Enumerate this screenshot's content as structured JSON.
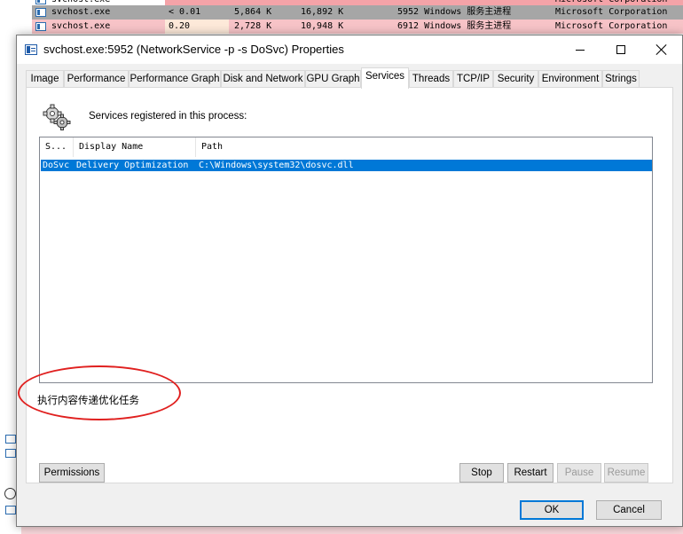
{
  "background": {
    "rows": [
      {
        "name": "svchost.exe",
        "cpu": "",
        "private": "",
        "working_set": "",
        "description": "",
        "company": "Microsoft Corporation",
        "color": "#f4a3a8"
      },
      {
        "name": "svchost.exe",
        "cpu": "< 0.01",
        "private": "5,864 K",
        "working_set": "16,892 K",
        "description": "5952 Windows 服务主进程",
        "company": "Microsoft Corporation",
        "color": "#a0a0a0"
      },
      {
        "name": "svchost.exe",
        "cpu": "0.20",
        "private": "2,728 K",
        "working_set": "10,948 K",
        "description": "6912 Windows 服务主进程",
        "company": "Microsoft Corporation",
        "color": "#f4b6bb"
      }
    ]
  },
  "window": {
    "title": "svchost.exe:5952 (NetworkService -p -s DoSvc) Properties"
  },
  "tabs": [
    {
      "label": "Image"
    },
    {
      "label": "Performance"
    },
    {
      "label": "Performance Graph"
    },
    {
      "label": "Disk and Network"
    },
    {
      "label": "GPU Graph"
    },
    {
      "label": "Services",
      "active": true
    },
    {
      "label": "Threads"
    },
    {
      "label": "TCP/IP"
    },
    {
      "label": "Security"
    },
    {
      "label": "Environment"
    },
    {
      "label": "Strings"
    }
  ],
  "services_tab": {
    "caption": "Services registered in this process:",
    "columns": [
      "S...",
      "Display Name",
      "Path"
    ],
    "rows": [
      {
        "service": "DoSvc",
        "display_name": "Delivery Optimization",
        "path": "C:\\Windows\\system32\\dosvc.dll"
      }
    ],
    "description": "执行内容传递优化任务",
    "annotation_color": "#e0201f",
    "selection_color": "#0078d7"
  },
  "buttons": {
    "permissions": "Permissions",
    "stop": "Stop",
    "restart": "Restart",
    "pause": "Pause",
    "resume": "Resume",
    "ok": "OK",
    "cancel": "Cancel"
  }
}
